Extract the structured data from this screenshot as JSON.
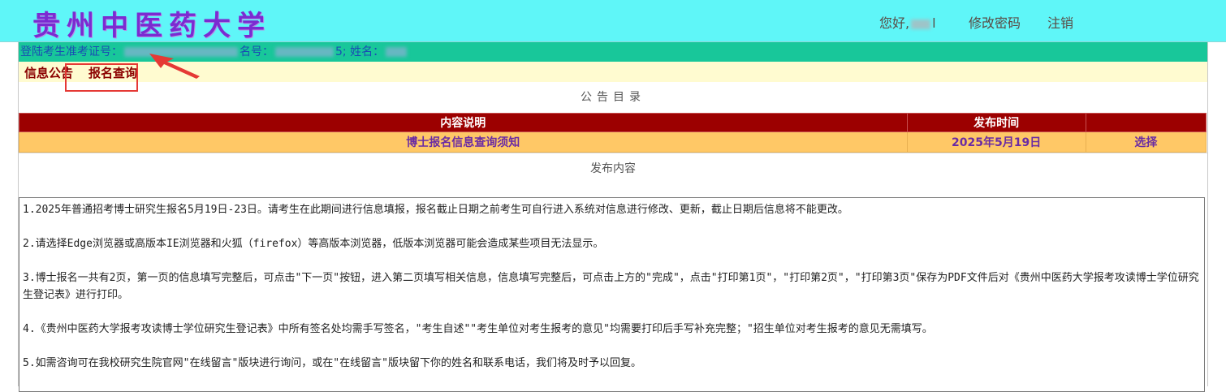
{
  "header": {
    "logo": "贵州中医药大学",
    "greeting": "您好,",
    "greeting_suffix": "l",
    "change_password": "修改密码",
    "logout": "注销"
  },
  "info_bar": {
    "label_exam_no": "登陆考生准考证号：",
    "label_reg_no": "名号：",
    "label_name_sep": "; 姓名：",
    "reg_tail": "5"
  },
  "tabs": {
    "info": "信息公告",
    "registration": "报名查询"
  },
  "catalog_title": "公告目录",
  "table": {
    "headers": [
      "内容说明",
      "发布时间",
      ""
    ],
    "rows": [
      {
        "title": "博士报名信息查询须知",
        "date": "2025年5月19日",
        "action": "选择"
      }
    ]
  },
  "publish_title": "发布内容",
  "content": [
    "1.2025年普通招考博士研究生报名5月19日-23日。请考生在此期间进行信息填报，报名截止日期之前考生可自行进入系统对信息进行修改、更新，截止日期后信息将不能更改。",
    "2.请选择Edge浏览器或高版本IE浏览器和火狐（firefox）等高版本浏览器，低版本浏览器可能会造成某些项目无法显示。",
    "3.博士报名一共有2页，第一页的信息填写完整后，可点击\"下一页\"按钮，进入第二页填写相关信息，信息填写完整后，可点击上方的\"完成\"，点击\"打印第1页\"，\"打印第2页\"，\"打印第3页\"保存为PDF文件后对《贵州中医药大学报考攻读博士学位研究生登记表》进行打印。",
    "4.《贵州中医药大学报考攻读博士学位研究生登记表》中所有签名处均需手写签名，\"考生自述\"\"考生单位对考生报考的意见\"均需要打印后手写补充完整；\"招生单位对考生报考的意见无需填写。",
    "5.如需咨询可在我校研究生院官网\"在线留言\"版块进行询问，或在\"在线留言\"版块留下你的姓名和联系电话，我们将及时予以回复。"
  ]
}
